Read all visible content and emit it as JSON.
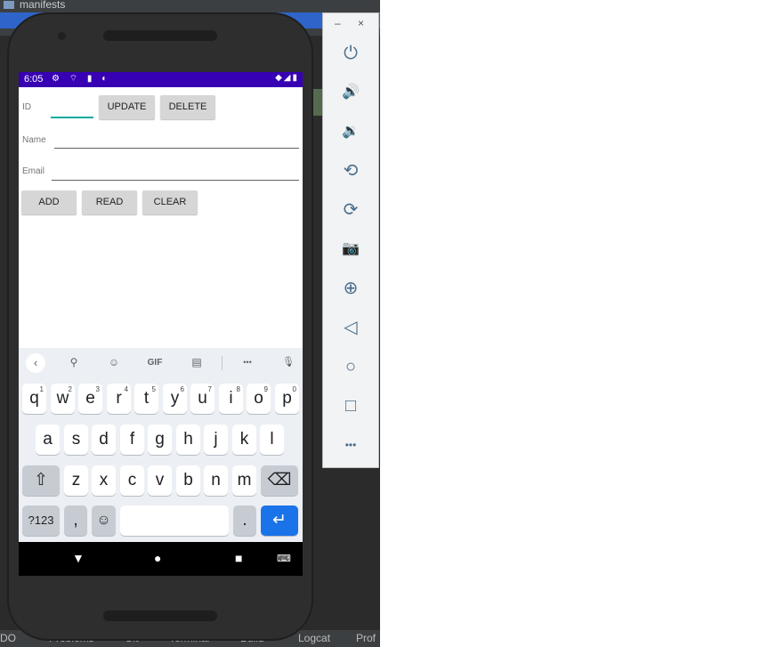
{
  "ide": {
    "tree_item": "manifests",
    "status_bar": {
      "left": "DO",
      "items": [
        "Problems",
        "Git",
        "Terminal",
        "Build",
        "Logcat",
        "Prof"
      ]
    }
  },
  "phone": {
    "status_bar": {
      "time": "6:05",
      "left_icons": "⚙ ⌔ ▮ ◐",
      "right_icons": "◆◢▮"
    },
    "form": {
      "id_label": "ID",
      "name_label": "Name",
      "email_label": "Email",
      "update_button": "UPDATE",
      "delete_button": "DELETE",
      "add_button": "ADD",
      "read_button": "READ",
      "clear_button": "CLEAR"
    },
    "keyboard": {
      "toolbar": {
        "back_icon": "‹",
        "search_icon": "⚲",
        "sticker_icon": "☺",
        "gif_label": "GIF",
        "clipboard_icon": "▤",
        "more_icon": "•••",
        "mic_icon": "🎙"
      },
      "row1": [
        {
          "key": "q",
          "hint": "1"
        },
        {
          "key": "w",
          "hint": "2"
        },
        {
          "key": "e",
          "hint": "3"
        },
        {
          "key": "r",
          "hint": "4"
        },
        {
          "key": "t",
          "hint": "5"
        },
        {
          "key": "y",
          "hint": "6"
        },
        {
          "key": "u",
          "hint": "7"
        },
        {
          "key": "i",
          "hint": "8"
        },
        {
          "key": "o",
          "hint": "9"
        },
        {
          "key": "p",
          "hint": "0"
        }
      ],
      "row2": [
        "a",
        "s",
        "d",
        "f",
        "g",
        "h",
        "j",
        "k",
        "l"
      ],
      "row3": [
        "z",
        "x",
        "c",
        "v",
        "b",
        "n",
        "m"
      ],
      "shift_icon": "⇧",
      "backspace_icon": "⌫",
      "symbols_key": "?123",
      "comma_key": ",",
      "emoji_icon": "☺",
      "period_key": ".",
      "enter_icon": "↵"
    },
    "nav_bar": {
      "back_icon": "▼",
      "home_icon": "●",
      "recents_icon": "■",
      "keyboard_icon": "⌨"
    }
  },
  "emulator_controls": {
    "minimize": "–",
    "close": "×",
    "buttons": [
      {
        "name": "power",
        "glyph": "⏻"
      },
      {
        "name": "volume-up",
        "glyph": "🔊"
      },
      {
        "name": "volume-down",
        "glyph": "🔉"
      },
      {
        "name": "rotate-left",
        "glyph": "⟲"
      },
      {
        "name": "rotate-right",
        "glyph": "⟳"
      },
      {
        "name": "camera",
        "glyph": "📷"
      },
      {
        "name": "zoom",
        "glyph": "⊕"
      },
      {
        "name": "back",
        "glyph": "◁"
      },
      {
        "name": "home",
        "glyph": "○"
      },
      {
        "name": "overview",
        "glyph": "□"
      },
      {
        "name": "more",
        "glyph": "•••"
      }
    ]
  },
  "colors": {
    "status_bar": "#3700b3",
    "accent": "#03a9a0",
    "enter_key": "#1a73e8",
    "ide_background": "#2b2b2b"
  }
}
